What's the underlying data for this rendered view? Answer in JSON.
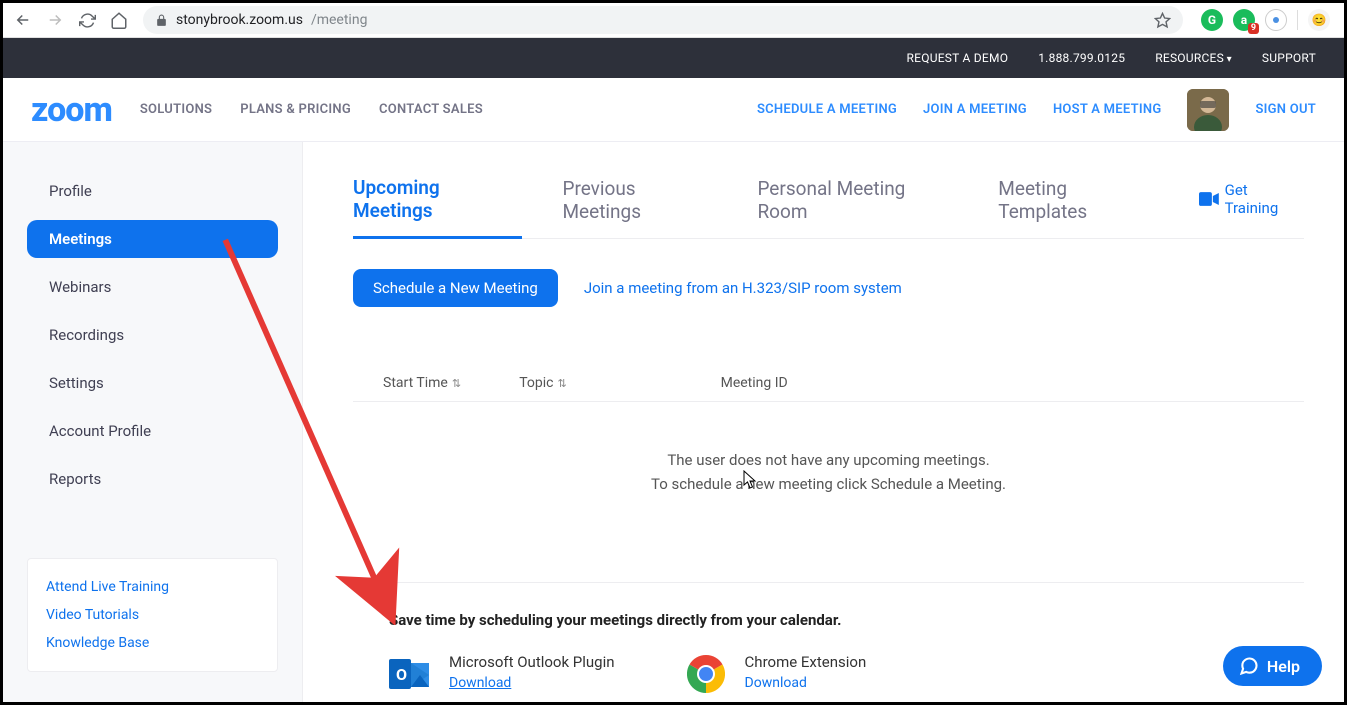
{
  "browser": {
    "url_host": "stonybrook.zoom.us",
    "url_path": "/meeting",
    "ext_badge": "9"
  },
  "darkbar": {
    "demo": "REQUEST A DEMO",
    "phone": "1.888.799.0125",
    "resources": "RESOURCES",
    "support": "SUPPORT"
  },
  "header": {
    "logo": "zoom",
    "nav_left": [
      "SOLUTIONS",
      "PLANS & PRICING",
      "CONTACT SALES"
    ],
    "nav_right": {
      "schedule": "SCHEDULE A MEETING",
      "join": "JOIN A MEETING",
      "host": "HOST A MEETING",
      "signout": "SIGN OUT"
    }
  },
  "sidebar": {
    "items": [
      "Profile",
      "Meetings",
      "Webinars",
      "Recordings",
      "Settings",
      "Account Profile",
      "Reports"
    ],
    "active_index": 1,
    "box": [
      "Attend Live Training",
      "Video Tutorials",
      "Knowledge Base"
    ]
  },
  "tabs": [
    "Upcoming Meetings",
    "Previous Meetings",
    "Personal Meeting Room",
    "Meeting Templates"
  ],
  "active_tab": 0,
  "get_training": "Get Training",
  "actions": {
    "schedule_btn": "Schedule a New Meeting",
    "sip_link": "Join a meeting from an H.323/SIP room system"
  },
  "table": {
    "col_start": "Start Time",
    "col_topic": "Topic",
    "col_mid": "Meeting ID",
    "empty1": "The user does not have any upcoming meetings.",
    "empty2": "To schedule a new meeting click Schedule a Meeting."
  },
  "calendar": {
    "title": "Save time by scheduling your meetings directly from your calendar.",
    "outlook": "Microsoft Outlook Plugin",
    "chrome": "Chrome Extension",
    "download": "Download"
  },
  "help": "Help"
}
